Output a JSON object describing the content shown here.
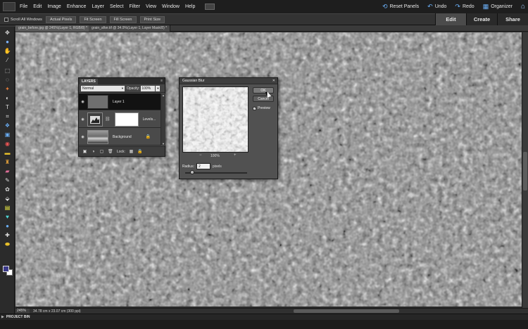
{
  "menubar": {
    "items": [
      "File",
      "Edit",
      "Image",
      "Enhance",
      "Layer",
      "Select",
      "Filter",
      "View",
      "Window",
      "Help"
    ],
    "reset_panels": "Reset Panels",
    "undo": "Undo",
    "redo": "Redo",
    "organizer": "Organizer"
  },
  "mode_tabs": {
    "edit": "Edit",
    "create": "Create",
    "share": "Share"
  },
  "options_bar": {
    "scroll_all": "Scroll All Windows",
    "actual_pixels": "Actual Pixels",
    "fit_screen": "Fit Screen",
    "fill_screen": "Fill Screen",
    "print_size": "Print Size"
  },
  "doc_tabs": [
    {
      "label": "grain_before.jpg @ 245%(Layer 1, RGB/8) *"
    },
    {
      "label": "grain_after.tif @ 34.9%(Layer 1, Layer Mask/8) *"
    }
  ],
  "layers_panel": {
    "title": "LAYERS",
    "blend_mode": "Normal",
    "opacity_label": "Opacity:",
    "opacity_value": "100%",
    "layers": [
      {
        "name": "Layer 1"
      },
      {
        "name": "Levels..."
      },
      {
        "name": "Background"
      }
    ],
    "lock_label": "Lock:"
  },
  "gaussian_blur": {
    "title": "Gaussian Blur",
    "ok": "OK",
    "cancel": "Cancel",
    "preview_label": "Preview",
    "zoom": "100%",
    "radius_label": "Radius:",
    "radius_value": "2",
    "radius_unit": "pixels"
  },
  "status": {
    "zoom": "245%",
    "doc_info": "34.78 cm x 23.07 cm (300 ppi)"
  },
  "project_bin": {
    "label": "PROJECT BIN"
  },
  "colors": {
    "foreground": "#3b3a8a",
    "background": "#ffffff",
    "accent": "#6aaef5"
  }
}
